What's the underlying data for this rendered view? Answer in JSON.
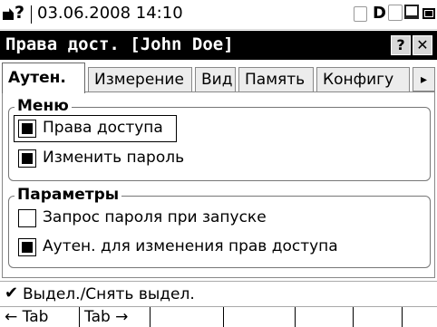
{
  "status_bar": {
    "question_mark": "?",
    "datetime": "03.06.2008  14:10",
    "d_indicator": "D",
    "icons": [
      "keyboard-icon",
      "document-icon",
      "printer-icon",
      "network-icon",
      "usb-icon",
      "battery-icon"
    ]
  },
  "title_bar": {
    "title": "Права дост. [John Doe]",
    "help_label": "?",
    "close_label": "✕"
  },
  "tabs": [
    {
      "label": "Аутен.",
      "active": true
    },
    {
      "label": "Измерение",
      "active": false
    },
    {
      "label": "Вид",
      "active": false
    },
    {
      "label": "Память",
      "active": false
    },
    {
      "label": "Конфигу",
      "active": false
    }
  ],
  "tab_scroll_label": "▸",
  "groups": {
    "menu": {
      "title": "Меню",
      "options": [
        {
          "label": "Права доступа",
          "checked": true
        },
        {
          "label": "Изменить пароль",
          "checked": true
        }
      ]
    },
    "params": {
      "title": "Параметры",
      "options": [
        {
          "label": "Запрос пароля при запуске",
          "checked": false
        },
        {
          "label": "Аутен. для изменения прав доступа",
          "checked": true
        }
      ]
    }
  },
  "hint": {
    "icon": "check-icon",
    "check_glyph": "✔",
    "text": "Выдел./Снять выдел."
  },
  "softkeys": [
    "← Tab",
    "Tab →",
    "",
    "",
    "",
    "",
    ""
  ]
}
